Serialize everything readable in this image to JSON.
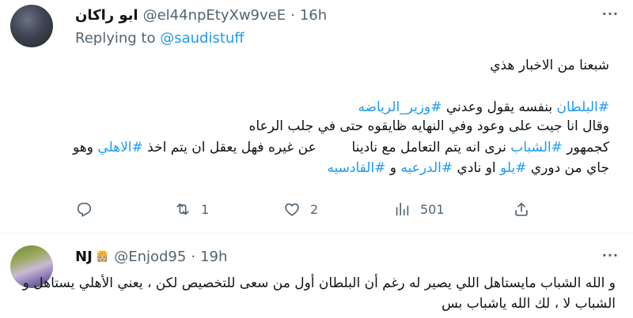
{
  "tweet1": {
    "author_name": "ابو راكان",
    "handle": "@el44npEtyXw9veE",
    "separator": "·",
    "time": "16h",
    "replying_prefix": "Replying to",
    "replying_mention": "@saudistuff",
    "more": "···",
    "body": {
      "line1": "شبعنا من الاخبار هذي",
      "line2": {
        "tag1": "#البلطان",
        "text1": " بنفسه يقول وعدني ",
        "tag2": "#وزير_الرياضه"
      },
      "line3": "وقال انا جيت على وعود وفي النهايه ظايقوه حتى في جلب الرعاه",
      "line4": {
        "text1": "كجمهور ",
        "tag1": "#الشباب",
        "text2": " نرى انه يتم التعامل مع نادينا ",
        "text3": " عن غيره فهل يعقل ان يتم اخذ ",
        "tag2": "#الاهلي",
        "text4": " وهو"
      },
      "line5": {
        "text1": "جاي من دوري ",
        "tag1": "#يلو",
        "text2": " او نادي ",
        "tag2": "#الدرعيه",
        "text3": " و ",
        "tag3": "#القادسيه"
      }
    },
    "actions": {
      "replies": "",
      "retweets": "1",
      "likes": "2",
      "views": "501"
    }
  },
  "tweet2": {
    "author_name": "NJ",
    "badge_emoji": "👸🏼",
    "handle": "@Enjod95",
    "separator": "·",
    "time": "19h",
    "more": "···",
    "body": {
      "line1": "و الله الشباب مايستاهل اللي يصير له رغم أن البلطان أول من سعى للتخصيص لكن ، يعني الأهلي يستاهل و",
      "line2": "الشباب لا ، لك الله ياشباب بس"
    }
  },
  "colors": {
    "accent": "#1d9bf0",
    "secondary_text": "#536471",
    "divider": "#eff3f4"
  },
  "icons": [
    "reply-icon",
    "retweet-icon",
    "like-icon",
    "views-icon",
    "share-icon",
    "more-icon"
  ]
}
